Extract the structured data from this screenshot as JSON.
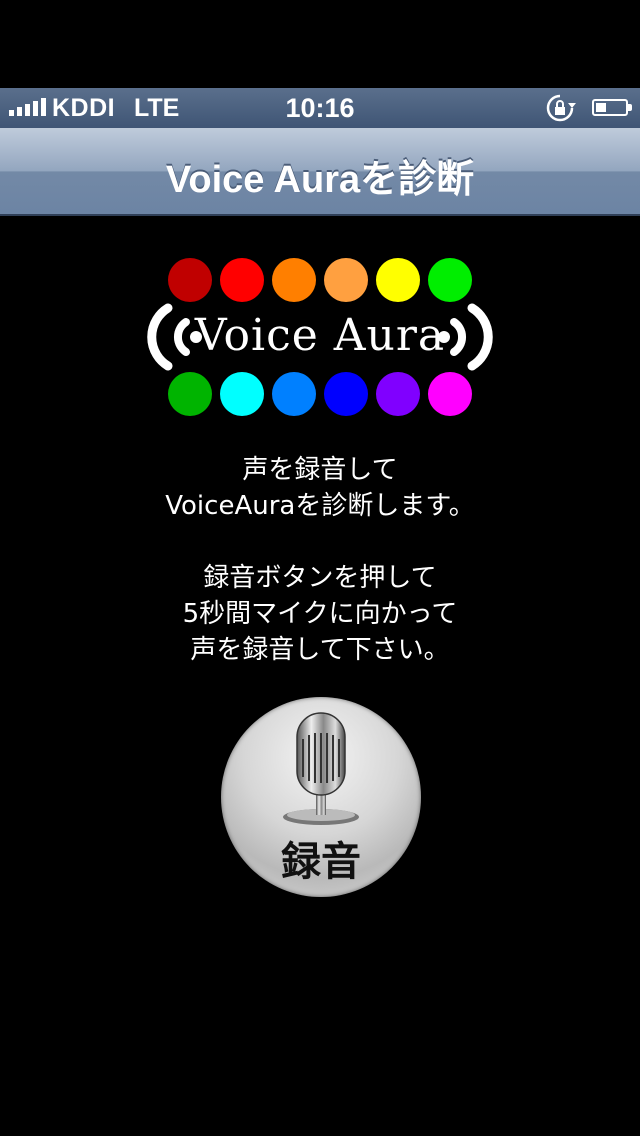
{
  "status_bar": {
    "carrier": "KDDI",
    "network": "LTE",
    "time": "10:16"
  },
  "nav_bar": {
    "title": "Voice Auraを診断"
  },
  "logo": {
    "wordmark": "Voice Aura",
    "top_dots": [
      "#c00000",
      "#ff0000",
      "#ff7f00",
      "#ffa040",
      "#ffff00",
      "#00ee00"
    ],
    "bottom_dots": [
      "#00b400",
      "#00ffff",
      "#0080ff",
      "#0000ff",
      "#8000ff",
      "#ff00ff"
    ]
  },
  "description": {
    "para1": [
      "声を録音して",
      "VoiceAuraを診断します。"
    ],
    "para2": [
      "録音ボタンを押して",
      "5秒間マイクに向かって",
      "声を録音して下さい。"
    ]
  },
  "record_button": {
    "label": "録音",
    "icon": "microphone-icon"
  }
}
